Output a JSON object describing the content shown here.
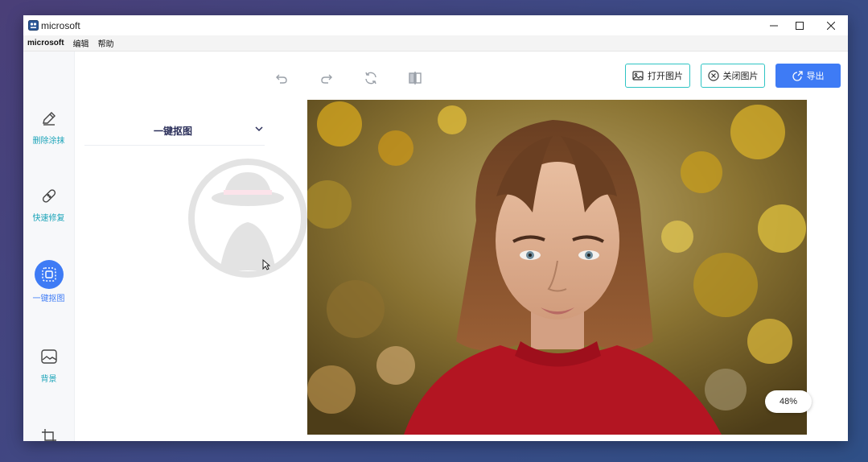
{
  "window": {
    "title": "microsoft"
  },
  "menubar": {
    "items": [
      "microsoft",
      "编辑",
      "帮助"
    ]
  },
  "sidebar": {
    "items": [
      {
        "label": "删除涂抹",
        "icon": "pencil-icon",
        "active": false
      },
      {
        "label": "快速修复",
        "icon": "bandage-icon",
        "active": false
      },
      {
        "label": "一键抠图",
        "icon": "cutout-icon",
        "active": true
      },
      {
        "label": "背景",
        "icon": "image-icon",
        "active": false
      },
      {
        "label": "",
        "icon": "crop-icon",
        "active": false
      }
    ]
  },
  "panel": {
    "title": "一键抠图"
  },
  "toolbar": {
    "open_image": "打开图片",
    "close_image": "关闭图片",
    "export": "导出"
  },
  "canvas": {
    "zoom": "48%"
  },
  "colors": {
    "accent": "#3e7bf5",
    "teal": "#1aa3b8",
    "outline": "#2ec4c4"
  }
}
